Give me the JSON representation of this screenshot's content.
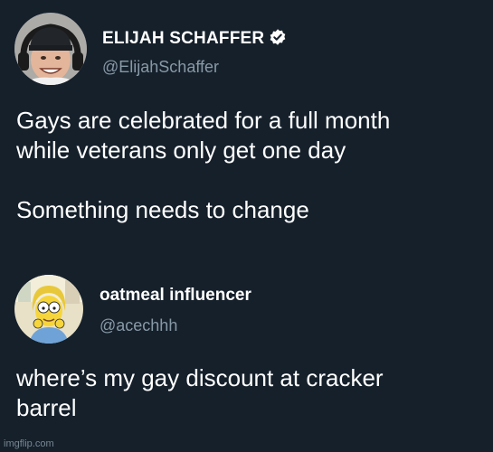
{
  "tweets": [
    {
      "author_name": "ELIJAH SCHAFFER",
      "handle": "@ElijahSchaffer",
      "verified": true,
      "body": "Gays are celebrated for a full month\nwhile veterans only get one day\n\nSomething needs to change"
    },
    {
      "author_name": "oatmeal influencer",
      "handle": "@acechhh",
      "verified": false,
      "body": "where’s my gay discount at cracker\nbarrel"
    }
  ],
  "watermark": "imgflip.com",
  "colors": {
    "background": "#15202b",
    "primary_text": "#ffffff",
    "secondary_text": "#8899a6",
    "verified_badge": "#ffffff"
  },
  "icons": {
    "verified": "verified-badge-icon"
  }
}
